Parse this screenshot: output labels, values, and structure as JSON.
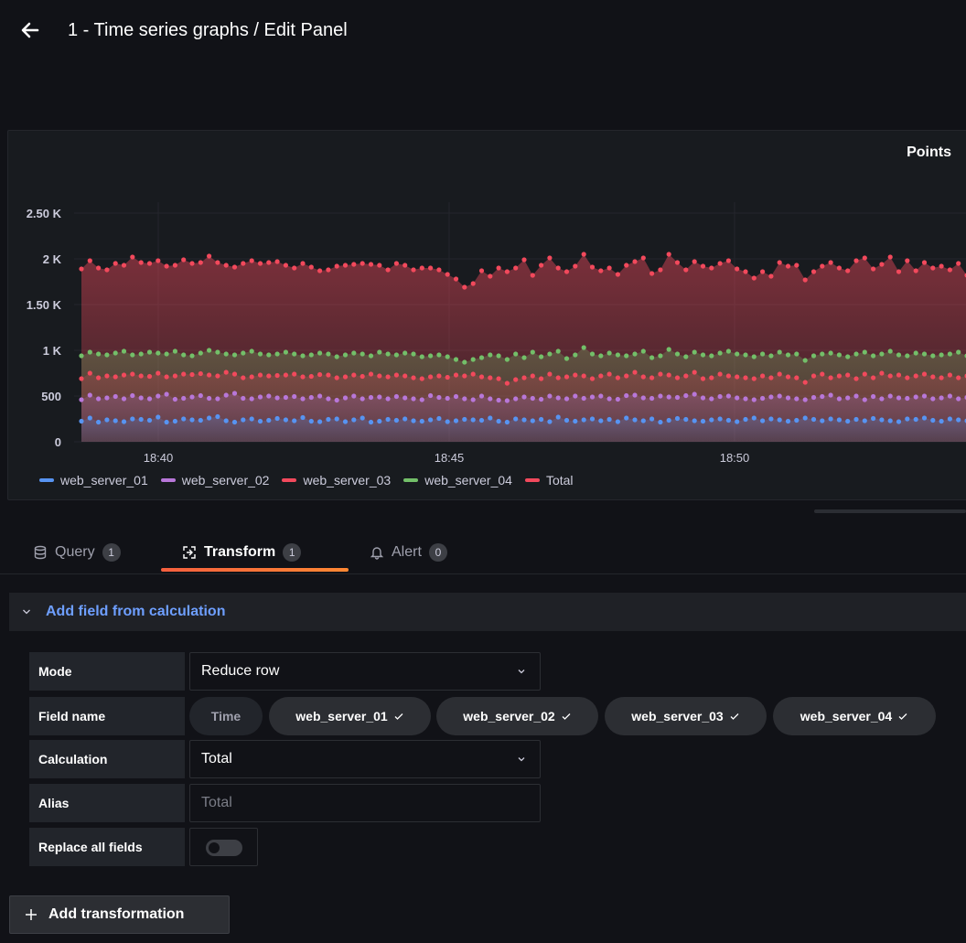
{
  "header": {
    "title": "1 - Time series graphs / Edit Panel"
  },
  "panel": {
    "title": "Points"
  },
  "colors": {
    "web_server_01": "#5794f2",
    "web_server_02": "#b877d9",
    "web_server_03": "#f2495c",
    "web_server_04": "#73bf69",
    "Total": "#f2495c",
    "accent": "#f55f3e",
    "link": "#6e9fff"
  },
  "chart_data": {
    "type": "line",
    "title": "Points",
    "x_ticks": [
      "18:40",
      "18:45",
      "18:50"
    ],
    "y_ticks": [
      "0",
      "500",
      "1 K",
      "1.50 K",
      "2 K",
      "2.50 K"
    ],
    "ylim": [
      0,
      2800
    ],
    "grid": true,
    "legend_position": "bottom-left",
    "series": [
      {
        "name": "web_server_01",
        "approx_level": 230,
        "values": [
          225,
          260,
          215,
          240,
          230,
          220,
          250,
          245,
          235,
          270,
          215,
          225,
          250,
          240,
          235,
          260,
          275,
          230,
          215,
          240,
          250,
          225,
          235,
          255,
          240,
          230,
          265,
          225,
          220,
          245,
          250,
          220,
          240,
          260,
          215,
          225,
          245,
          235,
          250,
          230,
          225,
          240,
          255,
          220,
          230,
          245,
          240,
          235,
          260,
          225,
          215,
          250,
          240,
          230,
          245,
          220,
          270,
          235,
          225,
          240,
          250,
          230,
          245,
          220,
          260,
          240,
          230,
          250,
          215,
          235,
          255,
          245,
          230,
          225,
          240,
          250,
          235,
          220,
          245,
          260,
          230,
          250,
          240,
          225,
          235,
          260,
          245,
          230,
          250,
          240,
          225,
          245,
          230,
          255,
          240,
          230,
          220,
          250,
          245,
          260,
          235,
          225,
          250,
          240,
          230
        ]
      },
      {
        "name": "web_server_02",
        "approx_level": 480,
        "values": [
          460,
          510,
          470,
          480,
          495,
          470,
          505,
          480,
          470,
          500,
          520,
          465,
          475,
          490,
          505,
          475,
          470,
          510,
          530,
          475,
          470,
          490,
          500,
          480,
          485,
          495,
          470,
          485,
          500,
          470,
          455,
          480,
          500,
          470,
          485,
          490,
          470,
          495,
          480,
          470,
          460,
          505,
          485,
          475,
          495,
          470,
          460,
          500,
          470,
          455,
          450,
          470,
          490,
          475,
          465,
          500,
          480,
          470,
          500,
          475,
          490,
          500,
          470,
          465,
          505,
          510,
          480,
          475,
          500,
          490,
          485,
          505,
          520,
          480,
          470,
          495,
          500,
          480,
          470,
          460,
          475,
          490,
          500,
          480,
          470,
          460,
          485,
          495,
          510,
          470,
          480,
          500,
          460,
          495,
          470,
          500,
          480,
          475,
          490,
          500,
          470,
          480,
          500,
          470,
          485
        ]
      },
      {
        "name": "web_server_03",
        "approx_level": 720,
        "values": [
          690,
          750,
          700,
          720,
          710,
          730,
          740,
          720,
          715,
          750,
          710,
          720,
          740,
          735,
          745,
          730,
          720,
          760,
          740,
          700,
          710,
          730,
          720,
          725,
          730,
          740,
          710,
          715,
          735,
          730,
          700,
          710,
          730,
          715,
          740,
          720,
          710,
          730,
          720,
          700,
          690,
          710,
          720,
          705,
          730,
          720,
          740,
          710,
          700,
          690,
          640,
          680,
          700,
          720,
          690,
          740,
          700,
          710,
          730,
          720,
          690,
          720,
          740,
          700,
          720,
          760,
          710,
          700,
          740,
          730,
          700,
          720,
          760,
          690,
          700,
          740,
          720,
          710,
          700,
          690,
          720,
          700,
          740,
          710,
          700,
          650,
          720,
          740,
          700,
          720,
          730,
          690,
          740,
          700,
          750,
          720,
          730,
          700,
          720,
          740,
          710,
          700,
          730,
          700,
          720
        ]
      },
      {
        "name": "web_server_04",
        "approx_level": 950,
        "values": [
          940,
          980,
          960,
          950,
          970,
          990,
          950,
          960,
          980,
          970,
          960,
          990,
          950,
          940,
          970,
          1000,
          980,
          960,
          950,
          970,
          990,
          960,
          950,
          960,
          980,
          960,
          940,
          950,
          970,
          960,
          930,
          950,
          970,
          960,
          940,
          980,
          960,
          950,
          970,
          960,
          930,
          940,
          950,
          930,
          900,
          870,
          900,
          920,
          950,
          940,
          900,
          960,
          920,
          980,
          930,
          960,
          990,
          910,
          950,
          1030,
          960,
          940,
          970,
          950,
          940,
          960,
          990,
          920,
          940,
          1010,
          960,
          930,
          980,
          950,
          940,
          970,
          990,
          960,
          950,
          930,
          960,
          940,
          980,
          950,
          960,
          890,
          940,
          960,
          970,
          950,
          930,
          960,
          980,
          940,
          960,
          990,
          950,
          940,
          970,
          960,
          940,
          950,
          960,
          980,
          940
        ]
      },
      {
        "name": "Total",
        "approx_level": 1900,
        "values": [
          1890,
          1980,
          1900,
          1880,
          1950,
          1930,
          2020,
          1960,
          1950,
          1980,
          1920,
          1930,
          1990,
          1950,
          1960,
          2030,
          1960,
          1930,
          1910,
          1950,
          1980,
          1950,
          1960,
          1970,
          1930,
          1900,
          1950,
          1910,
          1870,
          1880,
          1920,
          1930,
          1940,
          1950,
          1940,
          1930,
          1880,
          1950,
          1930,
          1880,
          1900,
          1900,
          1880,
          1830,
          1780,
          1690,
          1730,
          1870,
          1810,
          1900,
          1860,
          1900,
          1990,
          1820,
          1930,
          2010,
          1900,
          1860,
          1920,
          2050,
          1910,
          1870,
          1900,
          1830,
          1930,
          1970,
          2010,
          1840,
          1880,
          2050,
          1960,
          1880,
          1970,
          1920,
          1900,
          1950,
          1980,
          1890,
          1860,
          1790,
          1860,
          1810,
          1960,
          1920,
          1930,
          1770,
          1860,
          1920,
          1960,
          1900,
          1870,
          1980,
          2010,
          1890,
          1940,
          2020,
          1860,
          1980,
          1870,
          1960,
          1900,
          1920,
          1880,
          1950,
          1820
        ]
      }
    ]
  },
  "legend": [
    {
      "label": "web_server_01",
      "color": "#5794f2"
    },
    {
      "label": "web_server_02",
      "color": "#b877d9"
    },
    {
      "label": "web_server_03",
      "color": "#f2495c"
    },
    {
      "label": "web_server_04",
      "color": "#73bf69"
    },
    {
      "label": "Total",
      "color": "#f2495c"
    }
  ],
  "tabs": [
    {
      "label": "Query",
      "count": "1",
      "icon": "database-icon"
    },
    {
      "label": "Transform",
      "count": "1",
      "icon": "transform-icon"
    },
    {
      "label": "Alert",
      "count": "0",
      "icon": "bell-icon"
    }
  ],
  "transformation": {
    "title": "Add field from calculation",
    "mode_label": "Mode",
    "mode_value": "Reduce row",
    "field_name_label": "Field name",
    "fields": [
      "Time",
      "web_server_01",
      "web_server_02",
      "web_server_03",
      "web_server_04"
    ],
    "calculation_label": "Calculation",
    "calculation_value": "Total",
    "alias_label": "Alias",
    "alias_placeholder": "Total",
    "replace_label": "Replace all fields"
  },
  "add_transformation_label": "Add transformation"
}
